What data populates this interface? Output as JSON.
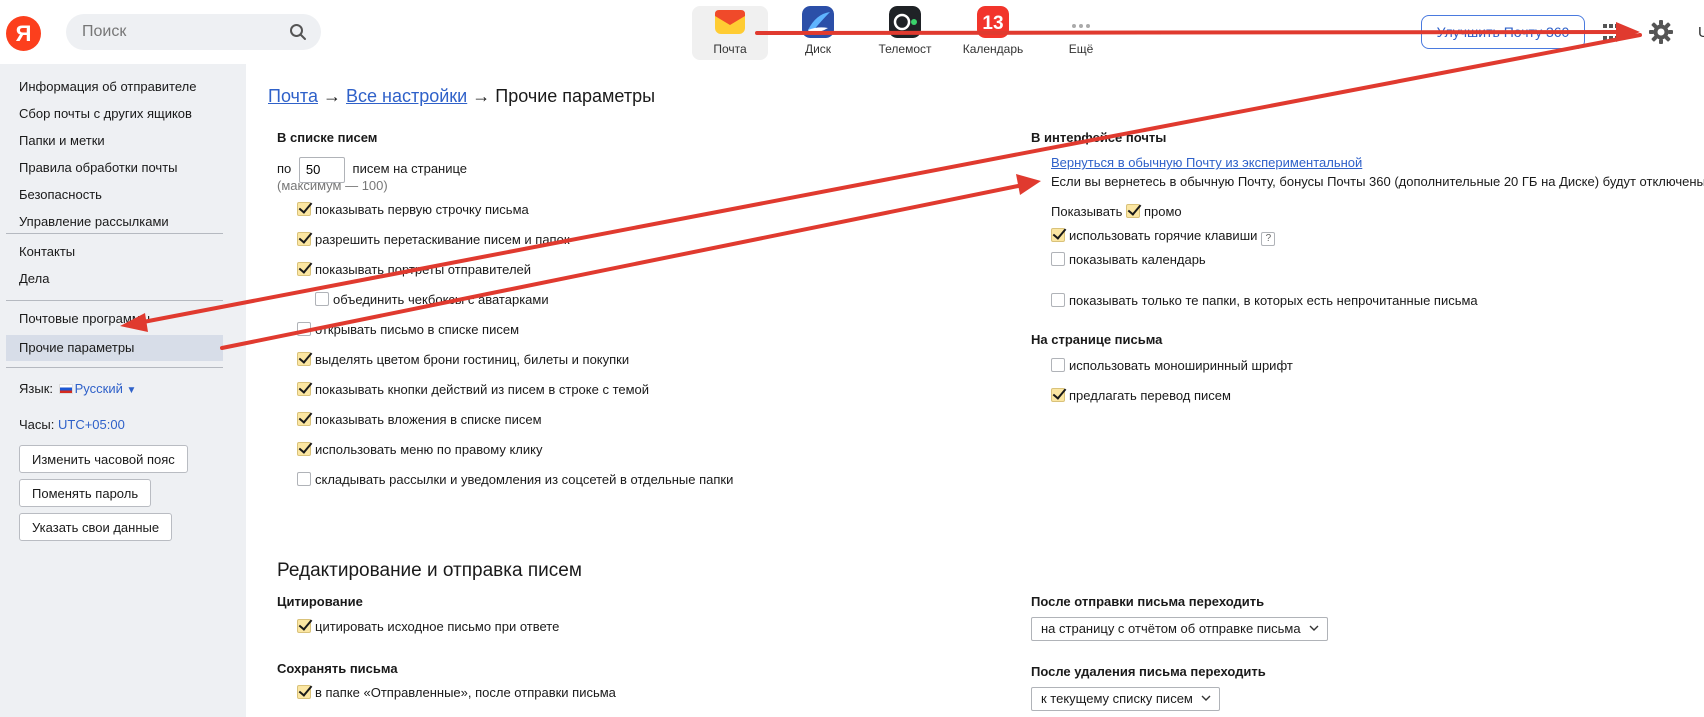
{
  "header": {
    "logo": "Я",
    "search": {
      "placeholder": "Поиск"
    },
    "apps": [
      {
        "label": "Почта"
      },
      {
        "label": "Диск"
      },
      {
        "label": "Телемост"
      },
      {
        "label": "Календарь",
        "badge": "13"
      },
      {
        "label": "Ещё"
      }
    ],
    "upgrade_label": "Улучшить Почту 360",
    "user_initial": "U"
  },
  "sidebar": {
    "group1": [
      "Информация об отправителе",
      "Сбор почты с других ящиков",
      "Папки и метки",
      "Правила обработки почты",
      "Безопасность",
      "Управление рассылками"
    ],
    "group2": [
      "Контакты",
      "Дела"
    ],
    "group3": [
      "Почтовые программы",
      "Прочие параметры"
    ],
    "active_item": "Прочие параметры",
    "language": {
      "label": "Язык:",
      "value": "Русский"
    },
    "clock": {
      "label": "Часы:",
      "value": "UTC+05:00"
    },
    "buttons": [
      "Изменить часовой пояс",
      "Поменять пароль",
      "Указать свои данные"
    ]
  },
  "breadcrumb": {
    "link1": "Почта",
    "separator": "→",
    "link2": "Все настройки",
    "current": "Прочие параметры"
  },
  "list_section": {
    "title": "В списке писем",
    "per_page_prefix": "по",
    "per_page_value": "50",
    "per_page_suffix": "писем на странице",
    "max_hint": "(максимум — 100)",
    "options": [
      {
        "label": "показывать первую строчку письма",
        "checked": true
      },
      {
        "label": "разрешить перетаскивание писем и папок",
        "checked": true
      },
      {
        "label": "показывать портреты отправителей",
        "checked": true
      },
      {
        "label": "объединить чекбоксы с аватарками",
        "checked": false
      },
      {
        "label": "открывать письмо в списке писем",
        "checked": false
      },
      {
        "label": "выделять цветом брони гостиниц, билеты и покупки",
        "checked": true
      },
      {
        "label": "показывать кнопки действий из писем в строке с темой",
        "checked": true
      },
      {
        "label": "показывать вложения в списке писем",
        "checked": true
      },
      {
        "label": "использовать меню по правому клику",
        "checked": true
      },
      {
        "label": "складывать рассылки и уведомления из соцсетей в отдельные папки",
        "checked": false
      }
    ]
  },
  "interface_section": {
    "title": "В интерфейсе почты",
    "exp_link": "Вернуться в обычную Почту из экспериментальной",
    "exp_note": "Если вы вернетесь в обычную Почту, бонусы Почты 360 (дополнительные 20 ГБ на Диске) будут отключены",
    "show_label": "Показывать",
    "promo_label": "промо",
    "promo_checked": true,
    "hotkeys_label": "использовать горячие клавиши",
    "hotkeys_checked": true,
    "help_glyph": "?",
    "calendar_label": "показывать календарь",
    "calendar_checked": false,
    "unread_label": "показывать только те папки, в которых есть непрочитанные письма",
    "unread_checked": false
  },
  "letter_page_section": {
    "title": "На странице письма",
    "mono_label": "использовать моноширинный шрифт",
    "mono_checked": false,
    "translate_label": "предлагать перевод писем",
    "translate_checked": true
  },
  "editing_section": {
    "title": "Редактирование и отправка писем",
    "quote_title": "Цитирование",
    "quote_label": "цитировать исходное письмо при ответе",
    "quote_checked": true,
    "save_title": "Сохранять письма",
    "save_label": "в папке «Отправленные», после отправки письма",
    "save_checked": true,
    "after_send_title": "После отправки письма переходить",
    "after_send_value": "на страницу с отчётом об отправке письма",
    "after_delete_title": "После удаления письма переходить",
    "after_delete_value": "к текущему списку писем"
  },
  "colors": {
    "accent": "#2f61c9",
    "annotation": "#e03a2f",
    "sidebar_bg": "#eef0f3",
    "checkbox_checked": "#fbe6a2"
  }
}
